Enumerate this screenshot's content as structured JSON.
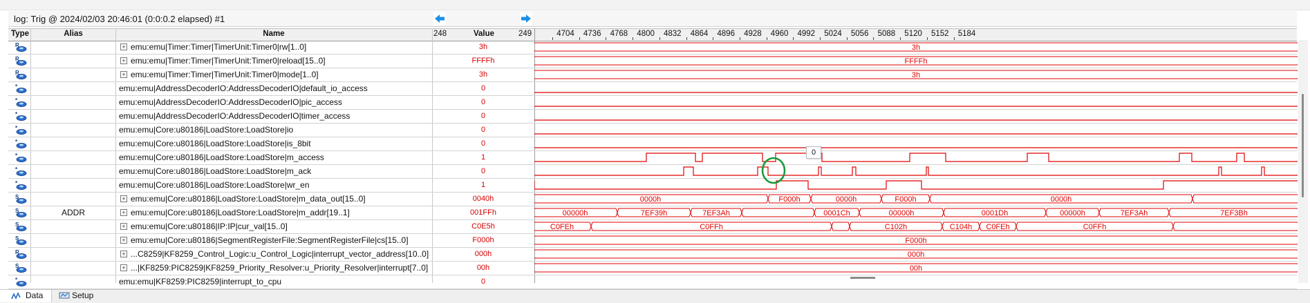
{
  "window": {
    "title": "log: Trig @ 2024/02/03 20:46:01 (0:0:0.2 elapsed) #1",
    "nav_left_icon": "arrow-left-icon",
    "nav_right_icon": "arrow-right-icon"
  },
  "header": {
    "type": "Type",
    "alias": "Alias",
    "name": "Name",
    "value_left": "248",
    "value": "Value",
    "value_right": "249",
    "ticks": [
      "4704",
      "4736",
      "4768",
      "4800",
      "4832",
      "4864",
      "4896",
      "4928",
      "4960",
      "4992",
      "5024",
      "5056",
      "5088",
      "5120",
      "5152",
      "5184"
    ]
  },
  "signals": [
    {
      "type": "R",
      "alias": "",
      "name": "emu:emu|Timer:Timer|TimerUnit:Timer0|rw[1..0]",
      "expandable": true,
      "value": "3h"
    },
    {
      "type": "R",
      "alias": "",
      "name": "emu:emu|Timer:Timer|TimerUnit:Timer0|reload[15..0]",
      "expandable": true,
      "value": "FFFFh"
    },
    {
      "type": "R",
      "alias": "",
      "name": "emu:emu|Timer:Timer|TimerUnit:Timer0|mode[1..0]",
      "expandable": true,
      "value": "3h"
    },
    {
      "type": "*",
      "alias": "",
      "name": "emu:emu|AddressDecoderIO:AddressDecoderIO|default_io_access",
      "expandable": false,
      "value": "0"
    },
    {
      "type": "*",
      "alias": "",
      "name": "emu:emu|AddressDecoderIO:AddressDecoderIO|pic_access",
      "expandable": false,
      "value": "0"
    },
    {
      "type": "*",
      "alias": "",
      "name": "emu:emu|AddressDecoderIO:AddressDecoderIO|timer_access",
      "expandable": false,
      "value": "0"
    },
    {
      "type": "*",
      "alias": "",
      "name": "emu:emu|Core:u80186|LoadStore:LoadStore|io",
      "expandable": false,
      "value": "0"
    },
    {
      "type": "*",
      "alias": "",
      "name": "emu:emu|Core:u80186|LoadStore:LoadStore|is_8bit",
      "expandable": false,
      "value": "0"
    },
    {
      "type": "*",
      "alias": "",
      "name": "emu:emu|Core:u80186|LoadStore:LoadStore|m_access",
      "expandable": false,
      "value": "1"
    },
    {
      "type": "*",
      "alias": "",
      "name": "emu:emu|Core:u80186|LoadStore:LoadStore|m_ack",
      "expandable": false,
      "value": "0"
    },
    {
      "type": "*",
      "alias": "",
      "name": "emu:emu|Core:u80186|LoadStore:LoadStore|wr_en",
      "expandable": false,
      "value": "1"
    },
    {
      "type": "S",
      "alias": "",
      "name": "emu:emu|Core:u80186|LoadStore:LoadStore|m_data_out[15..0]",
      "expandable": true,
      "value": "0040h"
    },
    {
      "type": "S",
      "alias": "ADDR",
      "name": "emu:emu|Core:u80186|LoadStore:LoadStore|m_addr[19..1]",
      "expandable": true,
      "value": "001FFh"
    },
    {
      "type": "S",
      "alias": "",
      "name": "emu:emu|Core:u80186|IP:IP|cur_val[15..0]",
      "expandable": true,
      "value": "C0E5h"
    },
    {
      "type": "S",
      "alias": "",
      "name": "emu:emu|Core:u80186|SegmentRegisterFile:SegmentRegisterFile|cs[15..0]",
      "expandable": true,
      "value": "F000h"
    },
    {
      "type": "R",
      "alias": "",
      "name": "...C8259|KF8259_Control_Logic:u_Control_Logic|interrupt_vector_address[10..0]",
      "expandable": true,
      "value": "000h"
    },
    {
      "type": "S",
      "alias": "",
      "name": "...|KF8259:PIC8259|KF8259_Priority_Resolver:u_Priority_Resolver|interrupt[7..0]",
      "expandable": true,
      "value": "00h"
    },
    {
      "type": "*",
      "alias": "",
      "name": "emu:emu|KF8259:PIC8259|interrupt_to_cpu",
      "expandable": false,
      "value": "0"
    }
  ],
  "waves": {
    "bus_labels": {
      "rw": [
        "3h"
      ],
      "reload": [
        "FFFFh"
      ],
      "mode": [
        "3h"
      ],
      "m_data_out": [
        "0000h",
        "F000h",
        "0000h",
        "F000h",
        "0000h"
      ],
      "m_addr": [
        "00000h",
        "7EF39h",
        "7EF3Ah",
        "0001Ch",
        "00000h",
        "0001Dh",
        "00000h",
        "7EF3Ah",
        "7EF3Bh"
      ],
      "cur_val": [
        "C0FEh",
        "C0FFh",
        "C102h",
        "C104h",
        "C0FEh",
        "C0FFh"
      ],
      "cs": [
        "F000h"
      ],
      "ivec": [
        "000h"
      ],
      "interrupt": [
        "00h"
      ]
    },
    "tooltip": "0"
  },
  "tabs": {
    "data": "Data",
    "setup": "Setup",
    "data_icon": "waveform-icon",
    "setup_icon": "setup-icon"
  },
  "colors": {
    "wave": "#e00000",
    "value_text": "#d40000",
    "marker_circle": "#1a9a3a",
    "nav_arrow": "#1e8fe6"
  }
}
